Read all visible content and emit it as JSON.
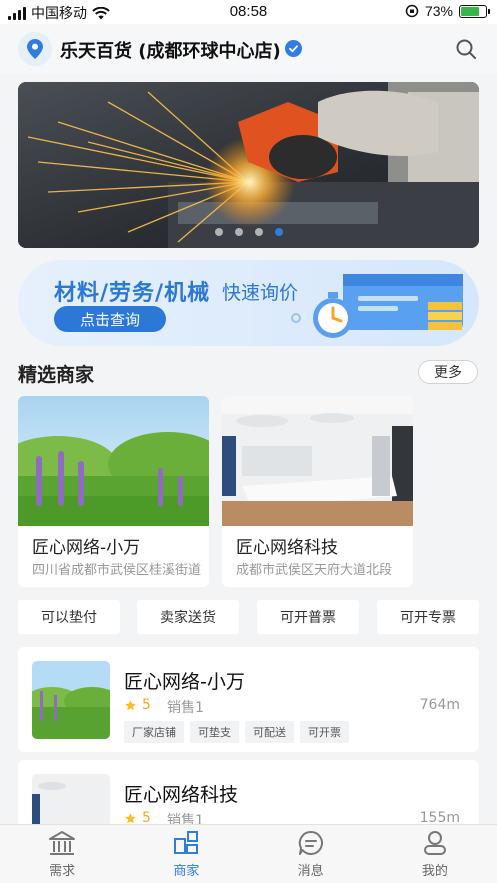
{
  "status": {
    "carrier": "中国移动",
    "time": "08:58",
    "battery": "73%",
    "battery_level": 0.73
  },
  "header": {
    "store_name": "乐天百货 (成都环球中心店)"
  },
  "banner": {
    "slide_count": 4,
    "active_index": 3
  },
  "promo": {
    "title": "材料/劳务/机械",
    "subtitle": "快速询价",
    "button": "点击查询"
  },
  "featured": {
    "title": "精选商家",
    "more": "更多",
    "cards": [
      {
        "name": "匠心网络-小万",
        "address": "四川省成都市武侯区桂溪街道"
      },
      {
        "name": "匠心网络科技",
        "address": "成都市武侯区天府大道北段"
      }
    ]
  },
  "filters": [
    "可以垫付",
    "卖家送货",
    "可开普票",
    "可开专票"
  ],
  "merchants": [
    {
      "name": "匠心网络-小万",
      "rating": "5",
      "sales": "销售1",
      "distance": "764m",
      "tags": [
        "厂家店铺",
        "可垫支",
        "可配送",
        "可开票"
      ]
    },
    {
      "name": "匠心网络科技",
      "rating": "5",
      "sales": "销售1",
      "distance": "155m",
      "tags": []
    }
  ],
  "tabs": [
    {
      "label": "需求",
      "icon": "building-icon"
    },
    {
      "label": "商家",
      "icon": "grid-icon"
    },
    {
      "label": "消息",
      "icon": "message-icon"
    },
    {
      "label": "我的",
      "icon": "user-icon"
    }
  ],
  "colors": {
    "accent": "#2f7de1",
    "rating": "#f5a623",
    "page_bg": "#f3f4f6"
  }
}
